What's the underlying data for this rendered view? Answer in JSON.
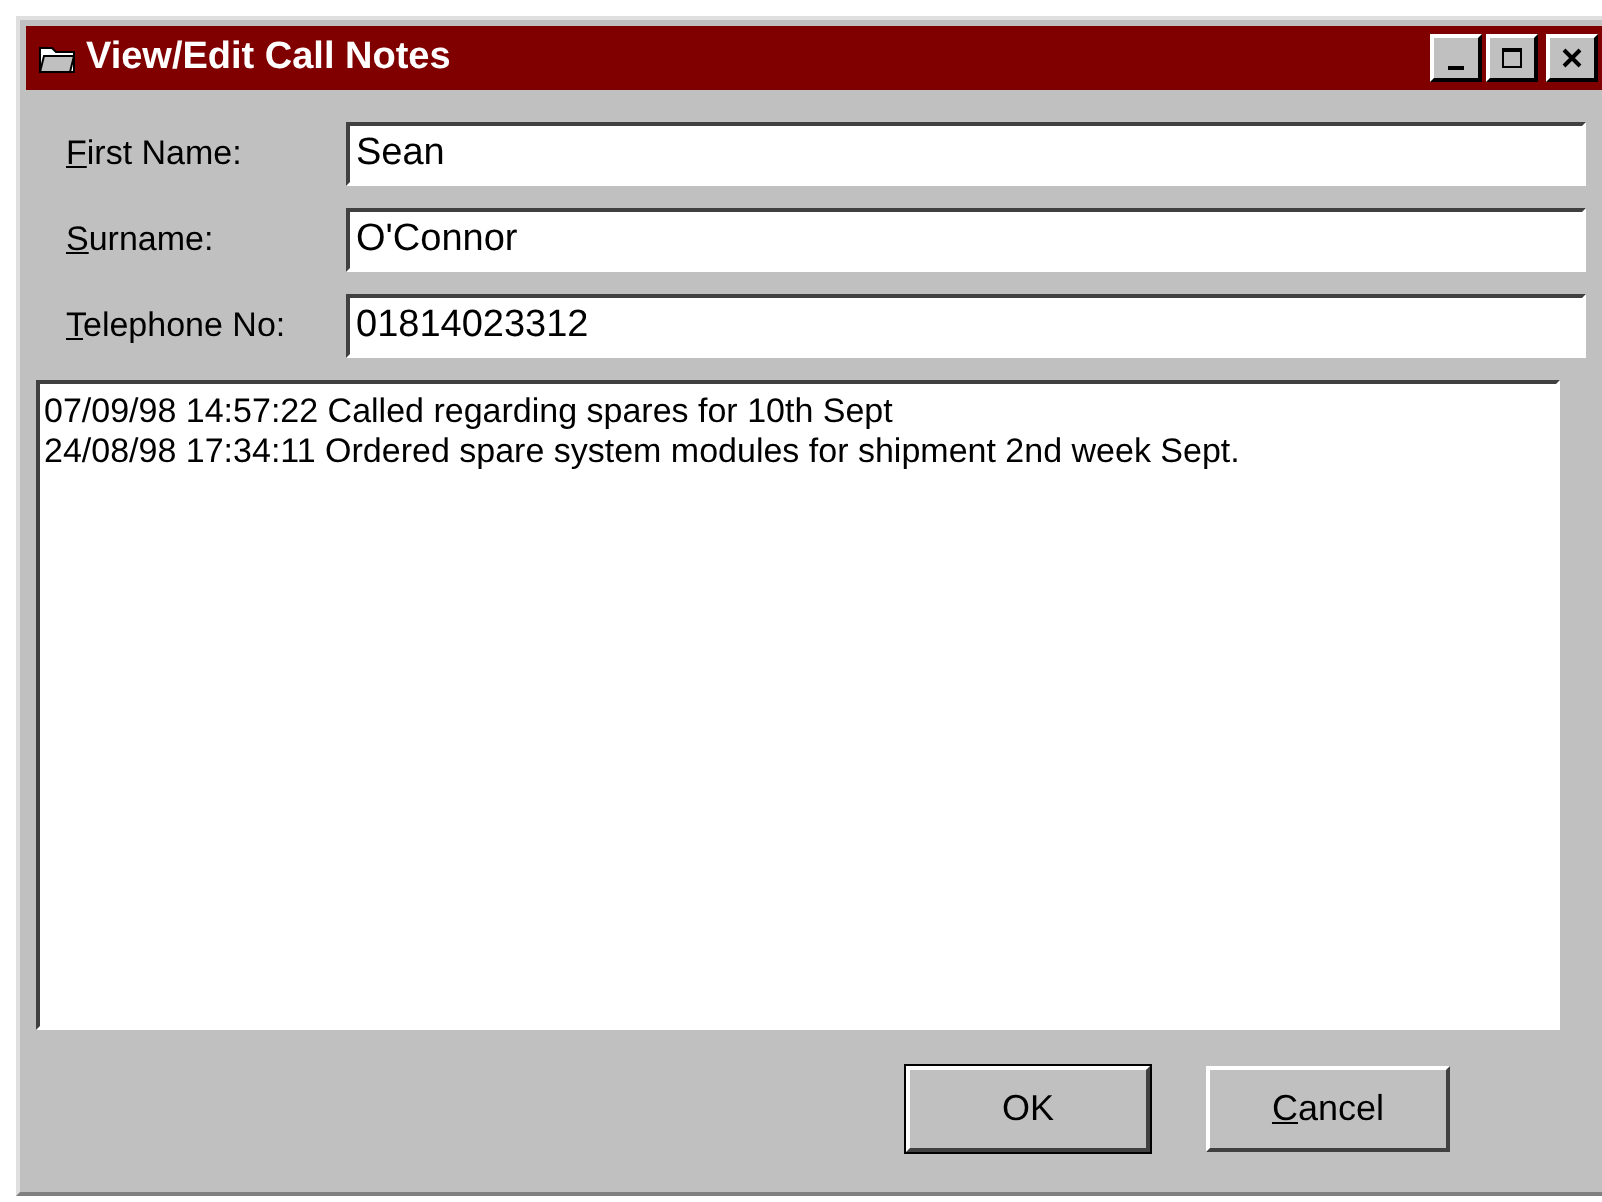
{
  "window": {
    "title": "View/Edit Call Notes"
  },
  "fields": [
    {
      "label": "First Name:",
      "access_key": true,
      "value": "Sean"
    },
    {
      "label": "Surname:",
      "access_key": true,
      "value": "O'Connor"
    },
    {
      "label": "Telephone No:",
      "access_key": true,
      "value": "01814023312"
    }
  ],
  "notes": [
    "07/09/98 14:57:22 Called regarding spares for 10th Sept",
    "24/08/98 17:34:11 Ordered spare system modules for shipment 2nd week Sept."
  ],
  "buttons": [
    {
      "label": "OK",
      "default": true,
      "access_key": false
    },
    {
      "label": "Cancel",
      "default": false,
      "access_key": true
    }
  ]
}
